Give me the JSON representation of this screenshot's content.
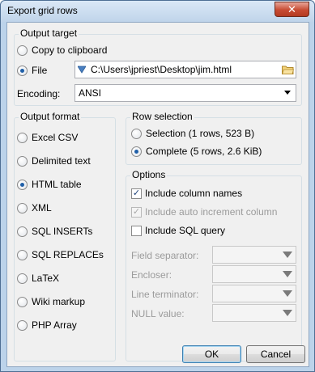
{
  "window": {
    "title": "Export grid rows",
    "close_glyph": "✕"
  },
  "output_target": {
    "legend": "Output target",
    "copy_label": "Copy to clipboard",
    "file_label": "File",
    "file_path": "C:\\Users\\jpriest\\Desktop\\jim.html",
    "encoding_label": "Encoding:",
    "encoding_value": "ANSI",
    "selected": "File"
  },
  "output_format": {
    "legend": "Output format",
    "options": [
      "Excel CSV",
      "Delimited text",
      "HTML table",
      "XML",
      "SQL INSERTs",
      "SQL REPLACEs",
      "LaTeX",
      "Wiki markup",
      "PHP Array"
    ],
    "selected": "HTML table"
  },
  "row_selection": {
    "legend": "Row selection",
    "selection_label": "Selection (1 rows, 523 B)",
    "complete_label": "Complete (5 rows, 2.6 KiB)",
    "selected": "Complete (5 rows, 2.6 KiB)"
  },
  "options": {
    "legend": "Options",
    "include_column_names": {
      "label": "Include column names",
      "checked": true,
      "enabled": true
    },
    "include_auto_increment": {
      "label": "Include auto increment column",
      "checked": true,
      "enabled": false
    },
    "include_sql_query": {
      "label": "Include SQL query",
      "checked": false,
      "enabled": true
    },
    "field_separator_label": "Field separator:",
    "encloser_label": "Encloser:",
    "line_terminator_label": "Line terminator:",
    "null_value_label": "NULL value:"
  },
  "buttons": {
    "ok": "OK",
    "cancel": "Cancel"
  },
  "icons": {
    "file_type": "funnel-icon",
    "browse": "folder-icon",
    "check": "✓"
  },
  "colors": {
    "accent": "#1f5fa8",
    "title_bar": "#bfd4ea",
    "close_button": "#c74b32"
  }
}
